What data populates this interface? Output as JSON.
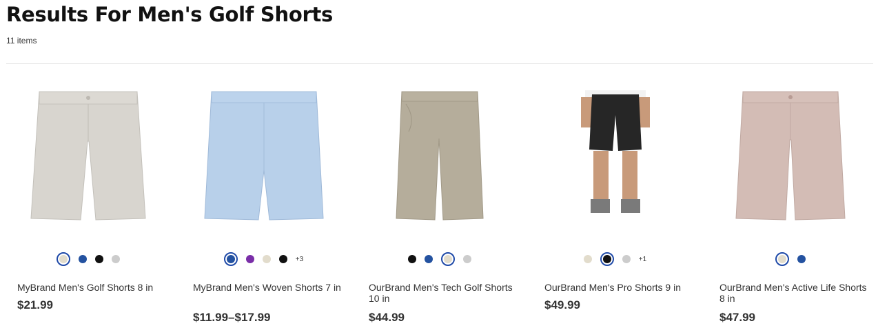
{
  "page": {
    "title": "Results For Men's Golf Shorts",
    "count": "11 items"
  },
  "products": [
    {
      "name": "MyBrand Men's Golf Shorts 8 in",
      "price": "$21.99",
      "image_icon": "light-gray-shorts-image",
      "swatches": [
        {
          "color": "#e2dccc",
          "selected": true
        },
        {
          "color": "#2452a0",
          "selected": false
        },
        {
          "color": "#111111",
          "selected": false
        },
        {
          "color": "#cccccc",
          "selected": false
        }
      ],
      "more": ""
    },
    {
      "name": "MyBrand Men's Woven Shorts 7 in",
      "price": "$11.99–$17.99",
      "image_icon": "light-blue-shorts-image",
      "swatches": [
        {
          "color": "#2452a0",
          "selected": true
        },
        {
          "color": "#7a2ea8",
          "selected": false
        },
        {
          "color": "#e2dccc",
          "selected": false
        },
        {
          "color": "#111111",
          "selected": false
        }
      ],
      "more": "+3"
    },
    {
      "name": "OurBrand Men's Tech Golf Shorts 10 in",
      "price": "$44.99",
      "image_icon": "khaki-shorts-back-image",
      "swatches": [
        {
          "color": "#111111",
          "selected": false
        },
        {
          "color": "#2452a0",
          "selected": false
        },
        {
          "color": "#e2dccc",
          "selected": true
        },
        {
          "color": "#cccccc",
          "selected": false
        }
      ],
      "more": ""
    },
    {
      "name": "OurBrand Men's Pro Shorts 9 in",
      "price": "$49.99",
      "image_icon": "model-black-shorts-image",
      "swatches": [
        {
          "color": "#e2dccc",
          "selected": false
        },
        {
          "color": "#111111",
          "selected": true
        },
        {
          "color": "#cccccc",
          "selected": false
        }
      ],
      "more": "+1"
    },
    {
      "name": "OurBrand Men's Active Life Shorts 8 in",
      "price": "$47.99",
      "image_icon": "mauve-shorts-image",
      "swatches": [
        {
          "color": "#e2dccc",
          "selected": true
        },
        {
          "color": "#2452a0",
          "selected": false
        }
      ],
      "more": ""
    }
  ]
}
